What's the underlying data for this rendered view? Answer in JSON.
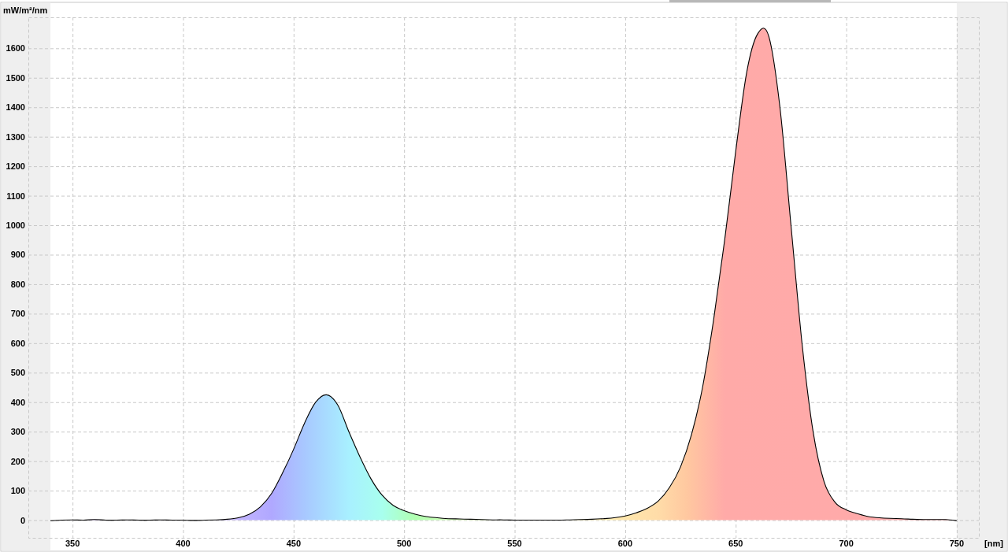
{
  "chart_data": {
    "type": "area",
    "ylabel": "mW/m²/nm",
    "xlabel": "[nm]",
    "x": [
      340,
      345,
      350,
      355,
      360,
      365,
      370,
      375,
      380,
      385,
      390,
      395,
      400,
      405,
      410,
      415,
      420,
      425,
      430,
      435,
      440,
      445,
      450,
      455,
      460,
      465,
      470,
      475,
      480,
      485,
      490,
      495,
      500,
      505,
      510,
      515,
      520,
      525,
      530,
      535,
      540,
      545,
      550,
      555,
      560,
      565,
      570,
      575,
      580,
      585,
      590,
      595,
      600,
      605,
      610,
      615,
      620,
      625,
      630,
      635,
      640,
      645,
      650,
      655,
      660,
      665,
      670,
      675,
      680,
      685,
      690,
      695,
      700,
      705,
      710,
      715,
      720,
      725,
      730,
      735,
      740,
      745,
      750
    ],
    "grid": true,
    "series": [
      {
        "color": "#000000",
        "values": [
          -2,
          0,
          1,
          0,
          2,
          0,
          0,
          1,
          0,
          0,
          1,
          0,
          0,
          -1,
          0,
          1,
          3,
          8,
          20,
          45,
          90,
          160,
          240,
          330,
          400,
          425,
          390,
          300,
          215,
          140,
          85,
          50,
          32,
          20,
          12,
          8,
          5,
          4,
          3,
          2,
          1,
          1,
          0,
          0,
          0,
          0,
          0,
          1,
          2,
          3,
          5,
          8,
          14,
          25,
          40,
          65,
          110,
          180,
          290,
          450,
          680,
          950,
          1250,
          1520,
          1650,
          1640,
          1400,
          1000,
          600,
          300,
          130,
          60,
          35,
          22,
          12,
          8,
          6,
          5,
          3,
          2,
          2,
          2,
          -2
        ]
      }
    ],
    "xlim": [
      330,
      760
    ],
    "ylim": [
      -60,
      1705
    ],
    "xticks": [
      350,
      400,
      450,
      500,
      550,
      600,
      650,
      700,
      750
    ],
    "yticks": [
      0,
      100,
      200,
      300,
      400,
      500,
      600,
      700,
      800,
      900,
      1000,
      1100,
      1200,
      1300,
      1400,
      1500,
      1600
    ]
  }
}
